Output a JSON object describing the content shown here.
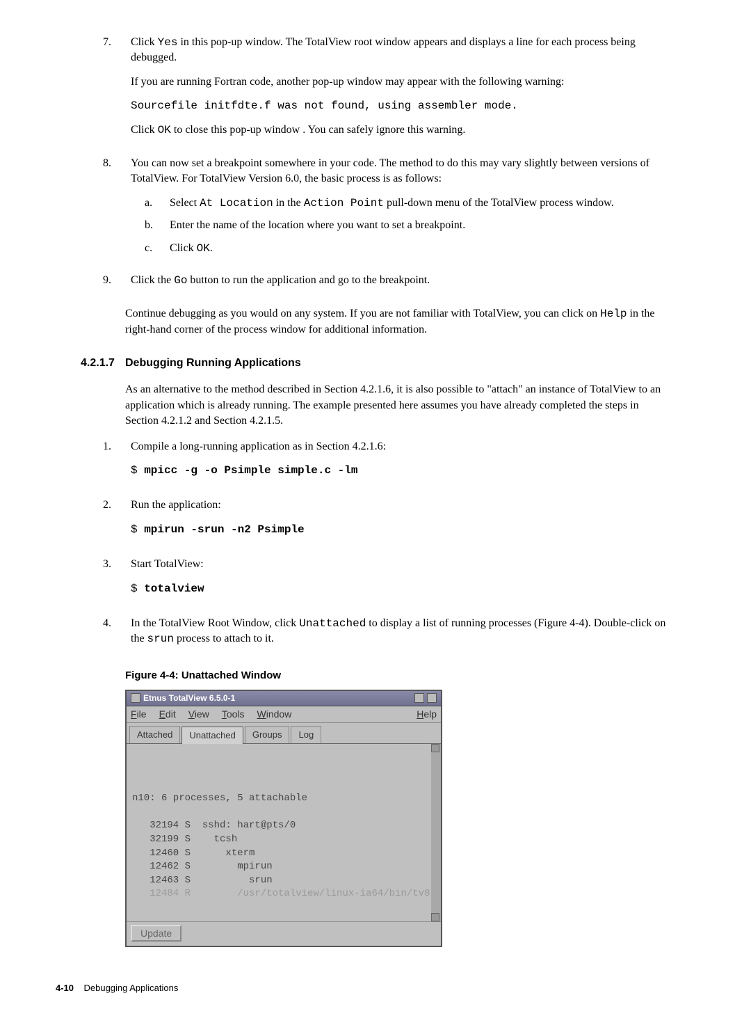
{
  "step7": {
    "num": "7.",
    "p1a": "Click ",
    "p1_code": "Yes",
    "p1b": " in this pop-up window.  The TotalView root window appears and displays a line for each process being debugged.",
    "p2": "If you are running Fortran code, another pop-up window may appear with the following warning:",
    "code1": "Sourcefile initfdte.f was not found, using assembler mode.",
    "p3a": "Click ",
    "p3_code": "OK",
    "p3b": " to close this pop-up window .  You can safely ignore this warning."
  },
  "step8": {
    "num": "8.",
    "p1": "You can now set a breakpoint somewhere in your code.  The method to do this may vary slightly between versions of TotalView.  For TotalView Version 6.0, the basic process is as follows:",
    "a": {
      "letter": "a.",
      "t1": "Select ",
      "c1": "At Location",
      "t2": " in the ",
      "c2": "Action Point",
      "t3": " pull-down menu of the TotalView process window."
    },
    "b": {
      "letter": "b.",
      "text": "Enter the name of the location where you want to set a breakpoint."
    },
    "c": {
      "letter": "c.",
      "t1": "Click ",
      "c1": "OK",
      "t2": "."
    }
  },
  "step9": {
    "num": "9.",
    "t1": "Click the ",
    "c1": "Go",
    "t2": " button to run the application and go to the breakpoint."
  },
  "postpara": {
    "t1": "Continue debugging as you would on any system.  If you are not familiar with TotalView, you can click on ",
    "c1": "Help",
    "t2": " in the right-hand corner of the process window for additional information."
  },
  "section": {
    "num": "4.2.1.7",
    "title": "Debugging Running Applications"
  },
  "intro": "As an alternative to the method described in Section 4.2.1.6, it is also possible to \"attach\" an instance of TotalView to an application which is already running.  The example presented here assumes you have already completed the steps in Section 4.2.1.2 and Section 4.2.1.5.",
  "s1": {
    "num": "1.",
    "text": "Compile a long-running application as in Section 4.2.1.6:",
    "prompt": "$ ",
    "cmd": "mpicc -g -o Psimple simple.c -lm"
  },
  "s2": {
    "num": "2.",
    "text": "Run the application:",
    "prompt": "$ ",
    "cmd": "mpirun -srun -n2 Psimple"
  },
  "s3": {
    "num": "3.",
    "text": "Start TotalView:",
    "prompt": "$ ",
    "cmd": "totalview"
  },
  "s4": {
    "num": "4.",
    "t1": "In the TotalView Root Window, click ",
    "c1": "Unattached",
    "t2": " to display a list of running processes (Figure  4-4).  Double-click on the ",
    "c2": "srun",
    "t3": " process to attach to it."
  },
  "figure": {
    "caption": "Figure  4-4:  Unattached Window",
    "title": "Etnus TotalView 6.5.0-1",
    "menu": {
      "file": "File",
      "edit": "Edit",
      "view": "View",
      "tools": "Tools",
      "window": "Window",
      "help": "Help"
    },
    "tabs": {
      "attached": "Attached",
      "unattached": "Unattached",
      "groups": "Groups",
      "log": "Log"
    },
    "heading": "n10: 6 processes, 5 attachable",
    "rows": [
      "   32194 S  sshd: hart@pts/0",
      "   32199 S    tcsh",
      "   12460 S      xterm",
      "   12462 S        mpirun",
      "   12463 S          srun",
      "   12484 R        /usr/totalview/linux-ia64/bin/tv8"
    ],
    "update": "Update"
  },
  "footer": {
    "page": "4-10",
    "label": "Debugging Applications"
  }
}
